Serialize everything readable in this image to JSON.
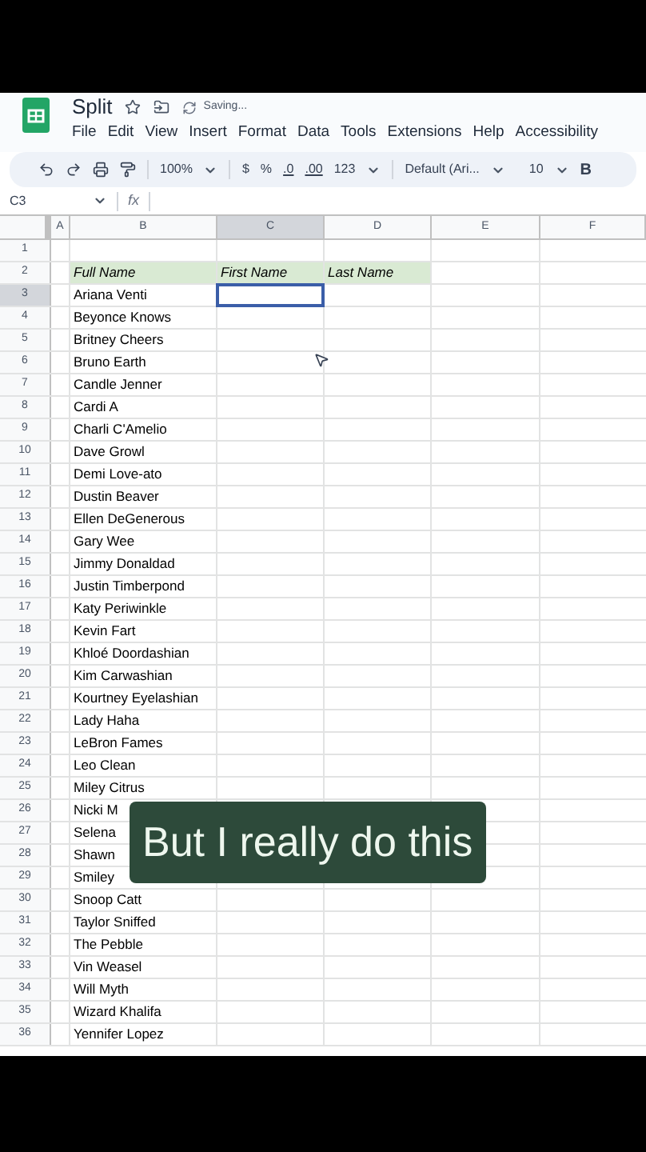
{
  "document": {
    "title": "Split",
    "status": "Saving..."
  },
  "menu": [
    "File",
    "Edit",
    "View",
    "Insert",
    "Format",
    "Data",
    "Tools",
    "Extensions",
    "Help",
    "Accessibility"
  ],
  "toolbar": {
    "zoom": "100%",
    "currency": "$",
    "percent": "%",
    "decrease_decimals": ".0",
    "increase_decimals": ".00",
    "number_format": "123",
    "font": "Default (Ari...",
    "font_size": "10",
    "bold": "B"
  },
  "formula_bar": {
    "cell_ref": "C3",
    "fx": "fx"
  },
  "columns": [
    {
      "label": "A",
      "selected": false
    },
    {
      "label": "B",
      "selected": false
    },
    {
      "label": "C",
      "selected": true
    },
    {
      "label": "D",
      "selected": false
    },
    {
      "label": "E",
      "selected": false
    },
    {
      "label": "F",
      "selected": false
    }
  ],
  "rows": [
    {
      "number": "1",
      "selected": false
    },
    {
      "number": "2",
      "selected": false,
      "header": true,
      "cells": [
        "Full Name",
        "First Name",
        "Last Name"
      ]
    },
    {
      "number": "3",
      "selected": true,
      "full_name": "Ariana Venti"
    },
    {
      "number": "4",
      "selected": false,
      "full_name": "Beyonce Knows"
    },
    {
      "number": "5",
      "selected": false,
      "full_name": "Britney Cheers"
    },
    {
      "number": "6",
      "selected": false,
      "full_name": "Bruno Earth"
    },
    {
      "number": "7",
      "selected": false,
      "full_name": "Candle Jenner"
    },
    {
      "number": "8",
      "selected": false,
      "full_name": "Cardi A"
    },
    {
      "number": "9",
      "selected": false,
      "full_name": "Charli C'Amelio"
    },
    {
      "number": "10",
      "selected": false,
      "full_name": "Dave Growl"
    },
    {
      "number": "11",
      "selected": false,
      "full_name": "Demi Love-ato"
    },
    {
      "number": "12",
      "selected": false,
      "full_name": "Dustin Beaver"
    },
    {
      "number": "13",
      "selected": false,
      "full_name": "Ellen DeGenerous"
    },
    {
      "number": "14",
      "selected": false,
      "full_name": "Gary Wee"
    },
    {
      "number": "15",
      "selected": false,
      "full_name": "Jimmy Donaldad"
    },
    {
      "number": "16",
      "selected": false,
      "full_name": "Justin Timberpond"
    },
    {
      "number": "17",
      "selected": false,
      "full_name": "Katy Periwinkle"
    },
    {
      "number": "18",
      "selected": false,
      "full_name": "Kevin Fart"
    },
    {
      "number": "19",
      "selected": false,
      "full_name": "Khloé Doordashian"
    },
    {
      "number": "20",
      "selected": false,
      "full_name": "Kim Carwashian"
    },
    {
      "number": "21",
      "selected": false,
      "full_name": "Kourtney Eyelashian"
    },
    {
      "number": "22",
      "selected": false,
      "full_name": "Lady Haha"
    },
    {
      "number": "23",
      "selected": false,
      "full_name": "LeBron Fames"
    },
    {
      "number": "24",
      "selected": false,
      "full_name": "Leo Clean"
    },
    {
      "number": "25",
      "selected": false,
      "full_name": "Miley Citrus"
    },
    {
      "number": "26",
      "selected": false,
      "full_name": "Nicki M"
    },
    {
      "number": "27",
      "selected": false,
      "full_name": "Selena"
    },
    {
      "number": "28",
      "selected": false,
      "full_name": "Shawn"
    },
    {
      "number": "29",
      "selected": false,
      "full_name": "Smiley"
    },
    {
      "number": "30",
      "selected": false,
      "full_name": "Snoop Catt"
    },
    {
      "number": "31",
      "selected": false,
      "full_name": "Taylor Sniffed"
    },
    {
      "number": "32",
      "selected": false,
      "full_name": "The Pebble"
    },
    {
      "number": "33",
      "selected": false,
      "full_name": "Vin Weasel"
    },
    {
      "number": "34",
      "selected": false,
      "full_name": "Will Myth"
    },
    {
      "number": "35",
      "selected": false,
      "full_name": "Wizard Khalifa"
    },
    {
      "number": "36",
      "selected": false,
      "full_name": "Yennifer Lopez"
    }
  ],
  "caption": "But I really do this"
}
